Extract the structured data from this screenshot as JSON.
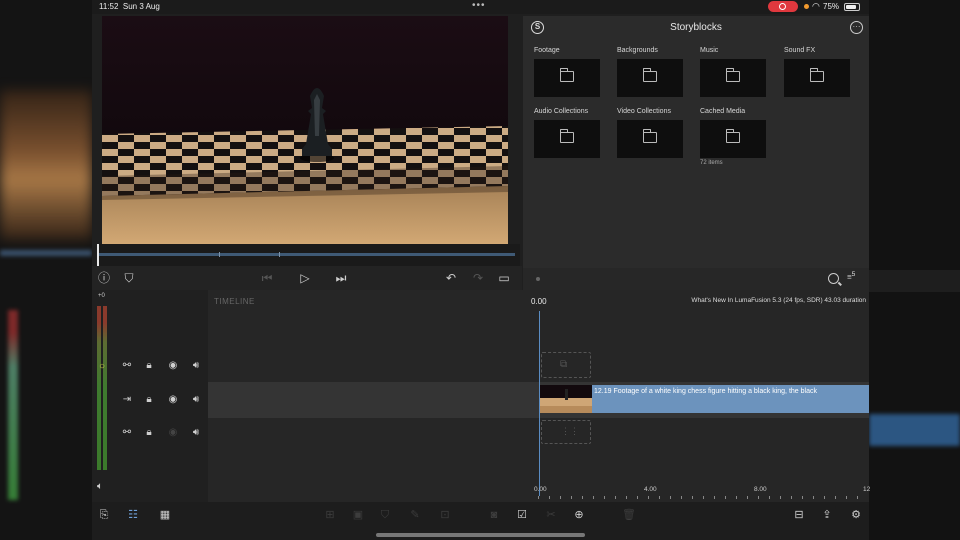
{
  "status_bar": {
    "time": "11:52",
    "date": "Sun 3 Aug",
    "battery": "75%",
    "dots": "•••"
  },
  "library": {
    "title": "Storyblocks",
    "logo_letter": "S",
    "more_icon": "ellipsis-circle-icon",
    "folders": [
      {
        "label": "Footage",
        "sub": ""
      },
      {
        "label": "Backgrounds",
        "sub": ""
      },
      {
        "label": "Music",
        "sub": ""
      },
      {
        "label": "Sound FX",
        "sub": ""
      },
      {
        "label": "Audio Collections",
        "sub": ""
      },
      {
        "label": "Video Collections",
        "sub": ""
      },
      {
        "label": "Cached Media",
        "sub": "72 items"
      }
    ],
    "sort_badge": "5"
  },
  "timeline": {
    "label": "TIMELINE",
    "current_time": "0.00",
    "project_info": "What's New In LumaFusion 5.3 (24 fps, SDR)  43.03 duration",
    "clip_text": "12.19  Footage of a white king chess figure hitting a black king, the black",
    "ruler": [
      "0.00",
      "4.00",
      "8.00",
      "12"
    ],
    "level_label": "+0"
  },
  "colors": {
    "accent_blue": "#6c93bd",
    "playhead": "#5a8cc2",
    "record_red": "#e0383e"
  }
}
